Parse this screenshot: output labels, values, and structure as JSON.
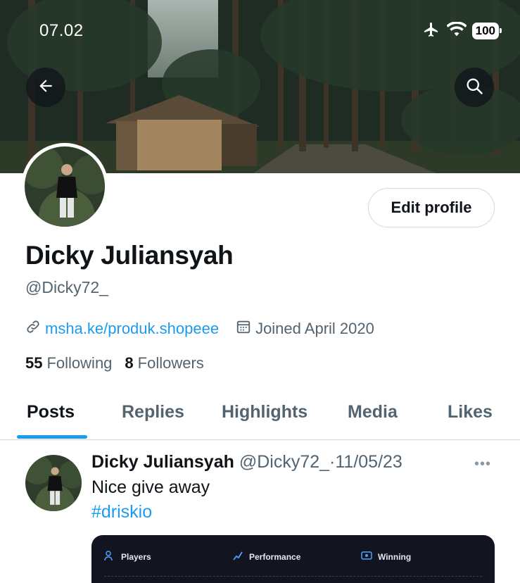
{
  "status_bar": {
    "time": "07.02",
    "battery": "100"
  },
  "profile": {
    "name": "Dicky Juliansyah",
    "handle": "@Dicky72_",
    "website": "msha.ke/produk.shopeee",
    "joined": "Joined April 2020",
    "following_count": "55",
    "following_label": "Following",
    "followers_count": "8",
    "followers_label": "Followers",
    "edit_button": "Edit profile"
  },
  "tabs": [
    {
      "label": "Posts",
      "active": true
    },
    {
      "label": "Replies"
    },
    {
      "label": "Highlights"
    },
    {
      "label": "Media"
    },
    {
      "label": "Likes"
    }
  ],
  "tweet": {
    "name": "Dicky Juliansyah",
    "handle": "@Dicky72_",
    "separator": "·",
    "date": "11/05/23",
    "more": "•••",
    "text": "Nice give away",
    "hashtag": "#driskio",
    "media_columns": [
      "Players",
      "Performance",
      "Winning"
    ]
  },
  "colors": {
    "accent": "#1d9bf0",
    "text_primary": "#0f1419",
    "text_secondary": "#536471",
    "border": "#cfd9de"
  },
  "icons": [
    "airplane-icon",
    "wifi-icon",
    "battery-icon",
    "back-arrow-icon",
    "search-icon",
    "link-icon",
    "calendar-icon",
    "more-icon"
  ]
}
